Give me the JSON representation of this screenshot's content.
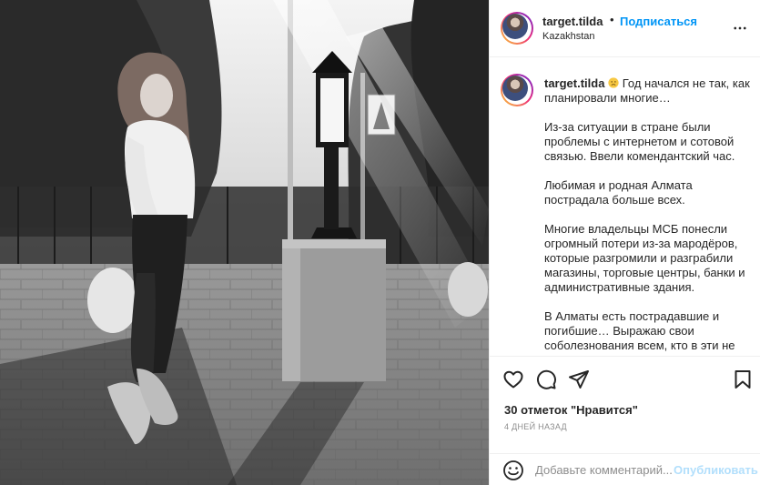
{
  "post": {
    "username": "target.tilda",
    "separator": "•",
    "follow_label": "Подписаться",
    "location": "Kazakhstan"
  },
  "caption": {
    "username": "target.tilda",
    "emoji_name": "slightly-frowning-face",
    "first_line": "Год начался не так, как планировали многие…",
    "paragraphs": [
      "Из-за ситуации в стране были проблемы с интернетом и сотовой связью. Ввели комендантский час.",
      "Любимая и родная Алмата пострадала больше всех.",
      "Многие владельцы МСБ понесли огромный потери из-за мародёров, которые разгромили и разграбили магазины, торговые центры, банки и административные здания.",
      "В Алматы есть пострадавшие и погибшие… Выражаю свои соболезнования всем, кто в эти не"
    ]
  },
  "actions": {
    "icons": [
      "heart-icon",
      "comment-icon",
      "share-icon",
      "bookmark-icon"
    ],
    "likes_text": "30 отметок \"Нравится\"",
    "time_text": "4 ДНЕЙ НАЗАД"
  },
  "comment": {
    "placeholder": "Добавьте комментарий...",
    "publish_label": "Опубликовать"
  },
  "colors": {
    "link_blue": "#0095f6",
    "publish_disabled": "#b2dffc",
    "text": "#262626",
    "muted": "#8e8e8e"
  }
}
